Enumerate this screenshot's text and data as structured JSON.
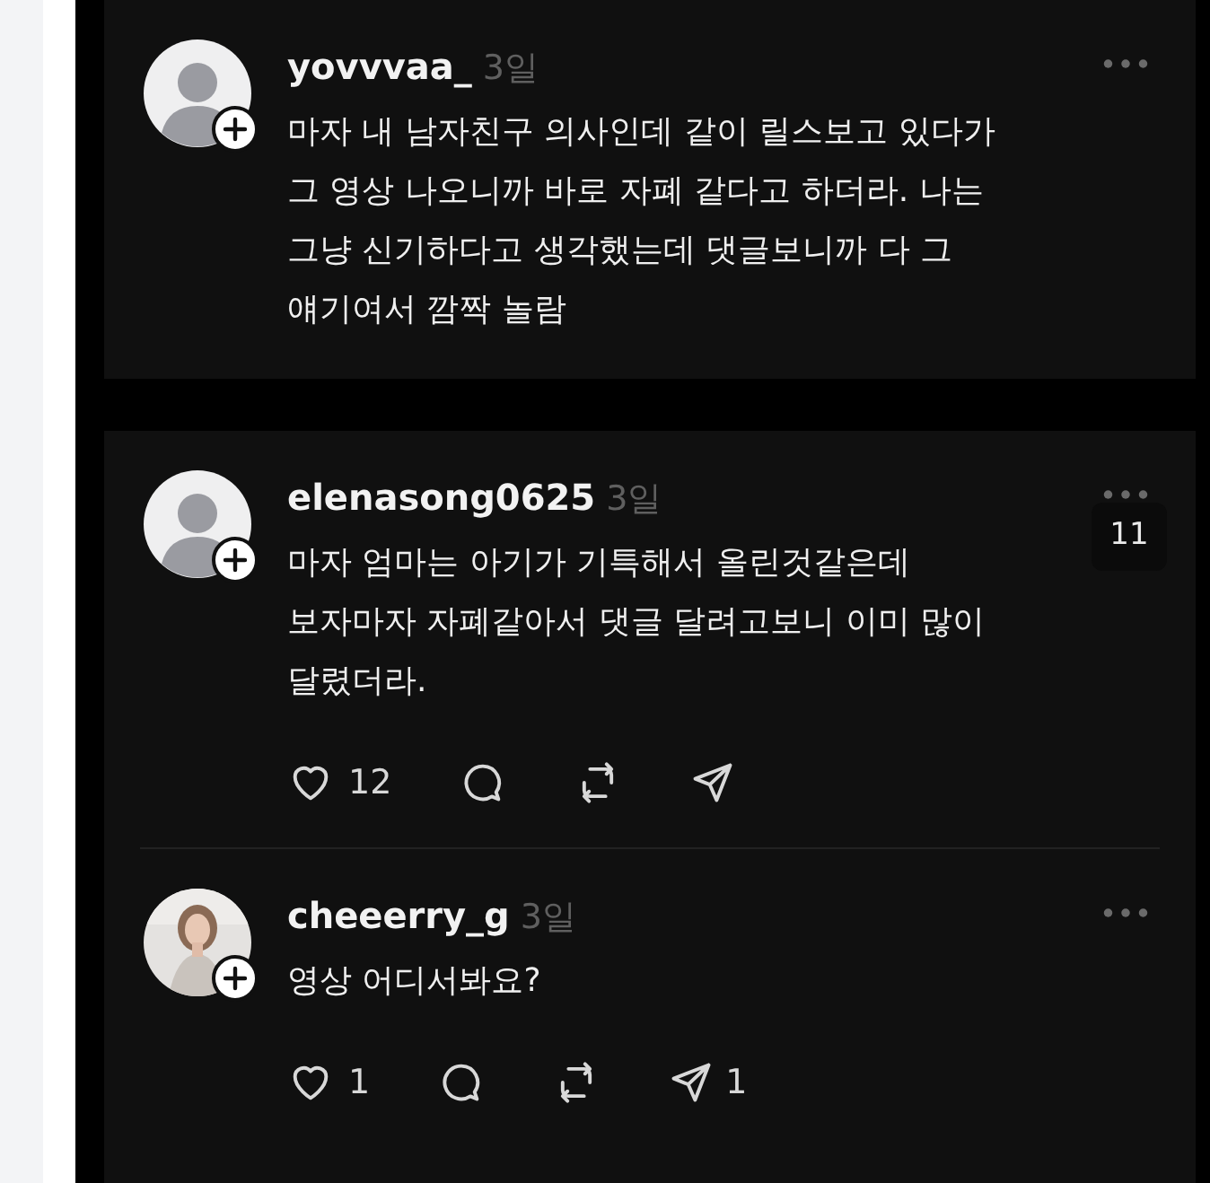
{
  "posts": [
    {
      "username": "yovvvaa_",
      "time": "3일",
      "has_photo": false,
      "text": "마자 내 남자친구 의사인데 같이 릴스보고 있다가\n그 영상 나오니까 바로 자폐 같다고 하더라. 나는\n그냥 신기하다고 생각했는데 댓글보니까 다 그\n얘기여서 깜짝 놀람"
    },
    {
      "username": "elenasong0625",
      "time": "3일",
      "has_photo": false,
      "badge": "11",
      "text": "마자 엄마는 아기가 기특해서 올린것같은데\n보자마자 자폐같아서 댓글 달려고보니 이미 많이\n달렸더라.",
      "actions": {
        "likes": "12"
      }
    },
    {
      "username": "cheeerry_g",
      "time": "3일",
      "has_photo": true,
      "text": "영상 어디서봐요?",
      "actions": {
        "likes": "1",
        "shares": "1"
      }
    }
  ]
}
